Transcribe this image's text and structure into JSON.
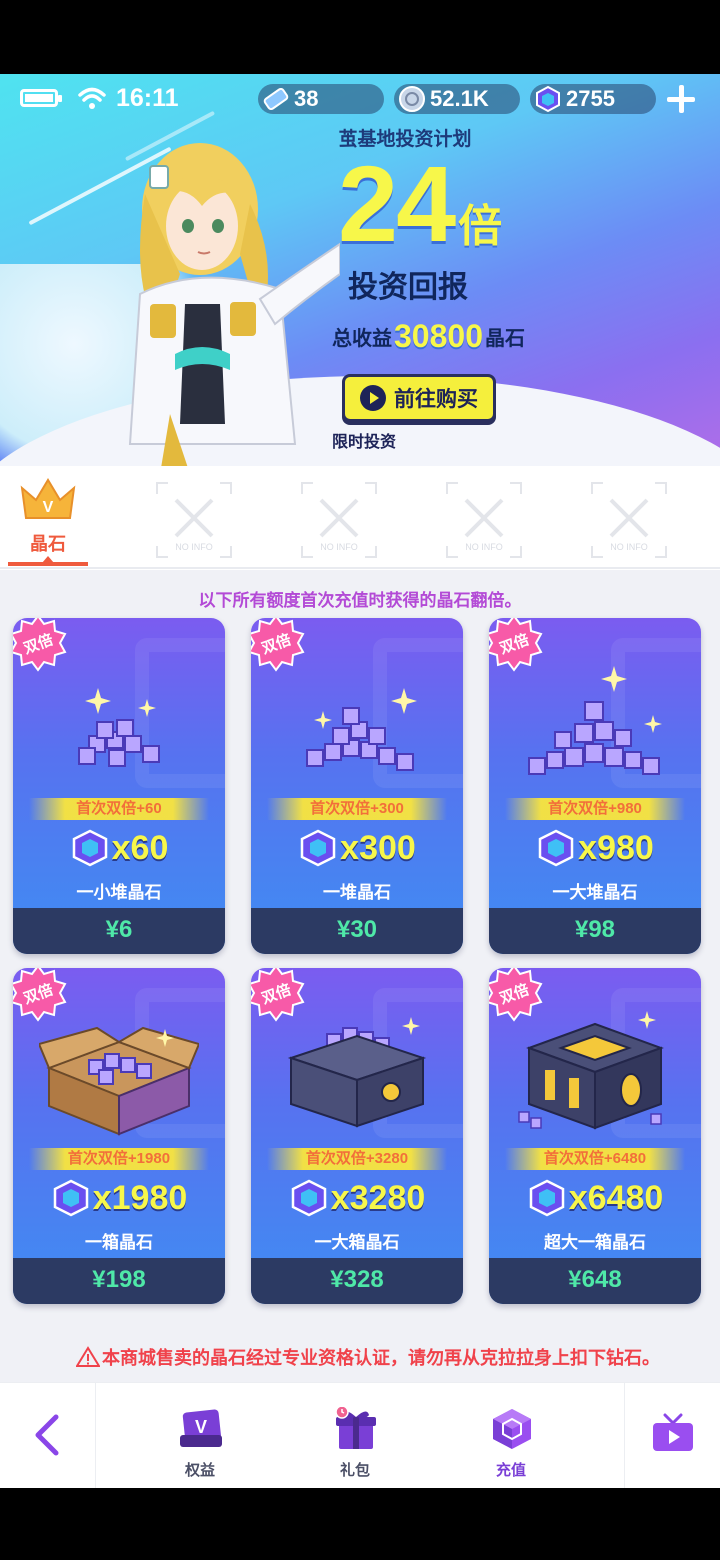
{
  "status_bar": {
    "time": "16:11"
  },
  "resources": {
    "stamina": {
      "icon": "ticket-icon",
      "value": "38"
    },
    "coins": {
      "icon": "coin-icon",
      "value": "52.1K"
    },
    "gems": {
      "icon": "crystal-cube-icon",
      "value": "2755"
    }
  },
  "banner": {
    "plan_title": "茧基地投资计划",
    "multiplier_number": "24",
    "multiplier_unit": "倍",
    "return_label": "投资回报",
    "total_prefix": "总收益",
    "total_value": "30800",
    "total_suffix": "晶石",
    "buy_button": "前往购买",
    "limited_text": "限时投资"
  },
  "tabs": {
    "active_label": "晶石",
    "empty_placeholder": "NO INFO"
  },
  "notice": "以下所有额度首次充值时获得的晶石翻倍。",
  "badge_label": "双倍",
  "cards": [
    {
      "bonus": "首次双倍+60",
      "amount": "x60",
      "name": "一小堆晶石",
      "price": "¥6"
    },
    {
      "bonus": "首次双倍+300",
      "amount": "x300",
      "name": "一堆晶石",
      "price": "¥30"
    },
    {
      "bonus": "首次双倍+980",
      "amount": "x980",
      "name": "一大堆晶石",
      "price": "¥98"
    },
    {
      "bonus": "首次双倍+1980",
      "amount": "x1980",
      "name": "一箱晶石",
      "price": "¥198"
    },
    {
      "bonus": "首次双倍+3280",
      "amount": "x3280",
      "name": "一大箱晶石",
      "price": "¥328"
    },
    {
      "bonus": "首次双倍+6480",
      "amount": "x6480",
      "name": "超大一箱晶石",
      "price": "¥648"
    }
  ],
  "warning": "本商城售卖的晶石经过专业资格认证，请勿再从克拉拉身上扣下钻石。",
  "bottom_nav": {
    "benefits": "权益",
    "gift": "礼包",
    "recharge": "充值"
  },
  "colors": {
    "accent_purple": "#7a3fd6",
    "price_green": "#4fe8a8",
    "amount_yellow": "#f7f74a",
    "tab_active": "#ef5a3d"
  }
}
